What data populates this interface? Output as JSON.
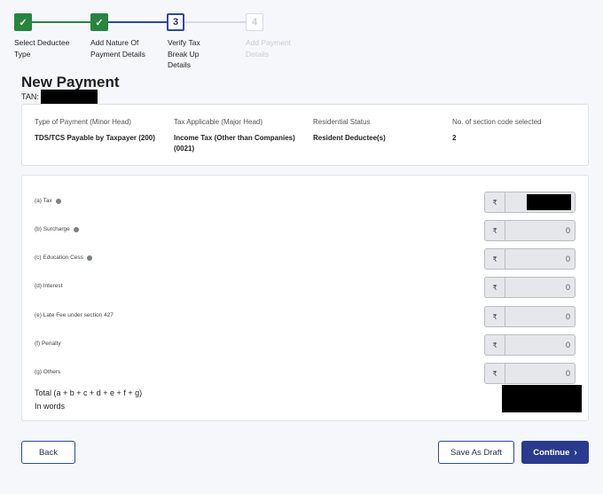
{
  "stepper": {
    "steps": [
      {
        "num": "✓",
        "label": "Select Deductee Type"
      },
      {
        "num": "✓",
        "label": "Add Nature Of Payment Details"
      },
      {
        "num": "3",
        "label": "Verify Tax Break Up Details"
      },
      {
        "num": "4",
        "label": "Add Payment Details"
      }
    ]
  },
  "page": {
    "title": "New Payment",
    "tan_label": "TAN:"
  },
  "info": {
    "type_head": "Type of Payment (Minor Head)",
    "type_val": "TDS/TCS Payable by Taxpayer (200)",
    "tax_head": "Tax Applicable (Major Head)",
    "tax_val": "Income Tax (Other than Companies) (0021)",
    "res_head": "Residential Status",
    "res_val": "Resident Deductee(s)",
    "sec_head": "No. of section code selected",
    "sec_val": "2"
  },
  "amounts": {
    "currency": "₹",
    "rows": [
      {
        "label": "(a) Tax",
        "value": ""
      },
      {
        "label": "(b) Surcharge",
        "value": "0"
      },
      {
        "label": "(c) Education Cess",
        "value": "0"
      },
      {
        "label": "(d) Interest",
        "value": "0"
      },
      {
        "label": "(e) Late Fee under section 427",
        "value": "0"
      },
      {
        "label": "(f) Penalty",
        "value": "0"
      },
      {
        "label": "(g) Others",
        "value": "0"
      }
    ],
    "total_label": "Total (a + b + c + d + e + f + g)",
    "words_label": "In words"
  },
  "buttons": {
    "back": "Back",
    "draft": "Save As Draft",
    "continue": "Continue",
    "continue_icon": "chevron-right-icon"
  },
  "colors": {
    "done": "#27853e",
    "active": "#2c4a9e",
    "primary": "#2a3a8c"
  }
}
